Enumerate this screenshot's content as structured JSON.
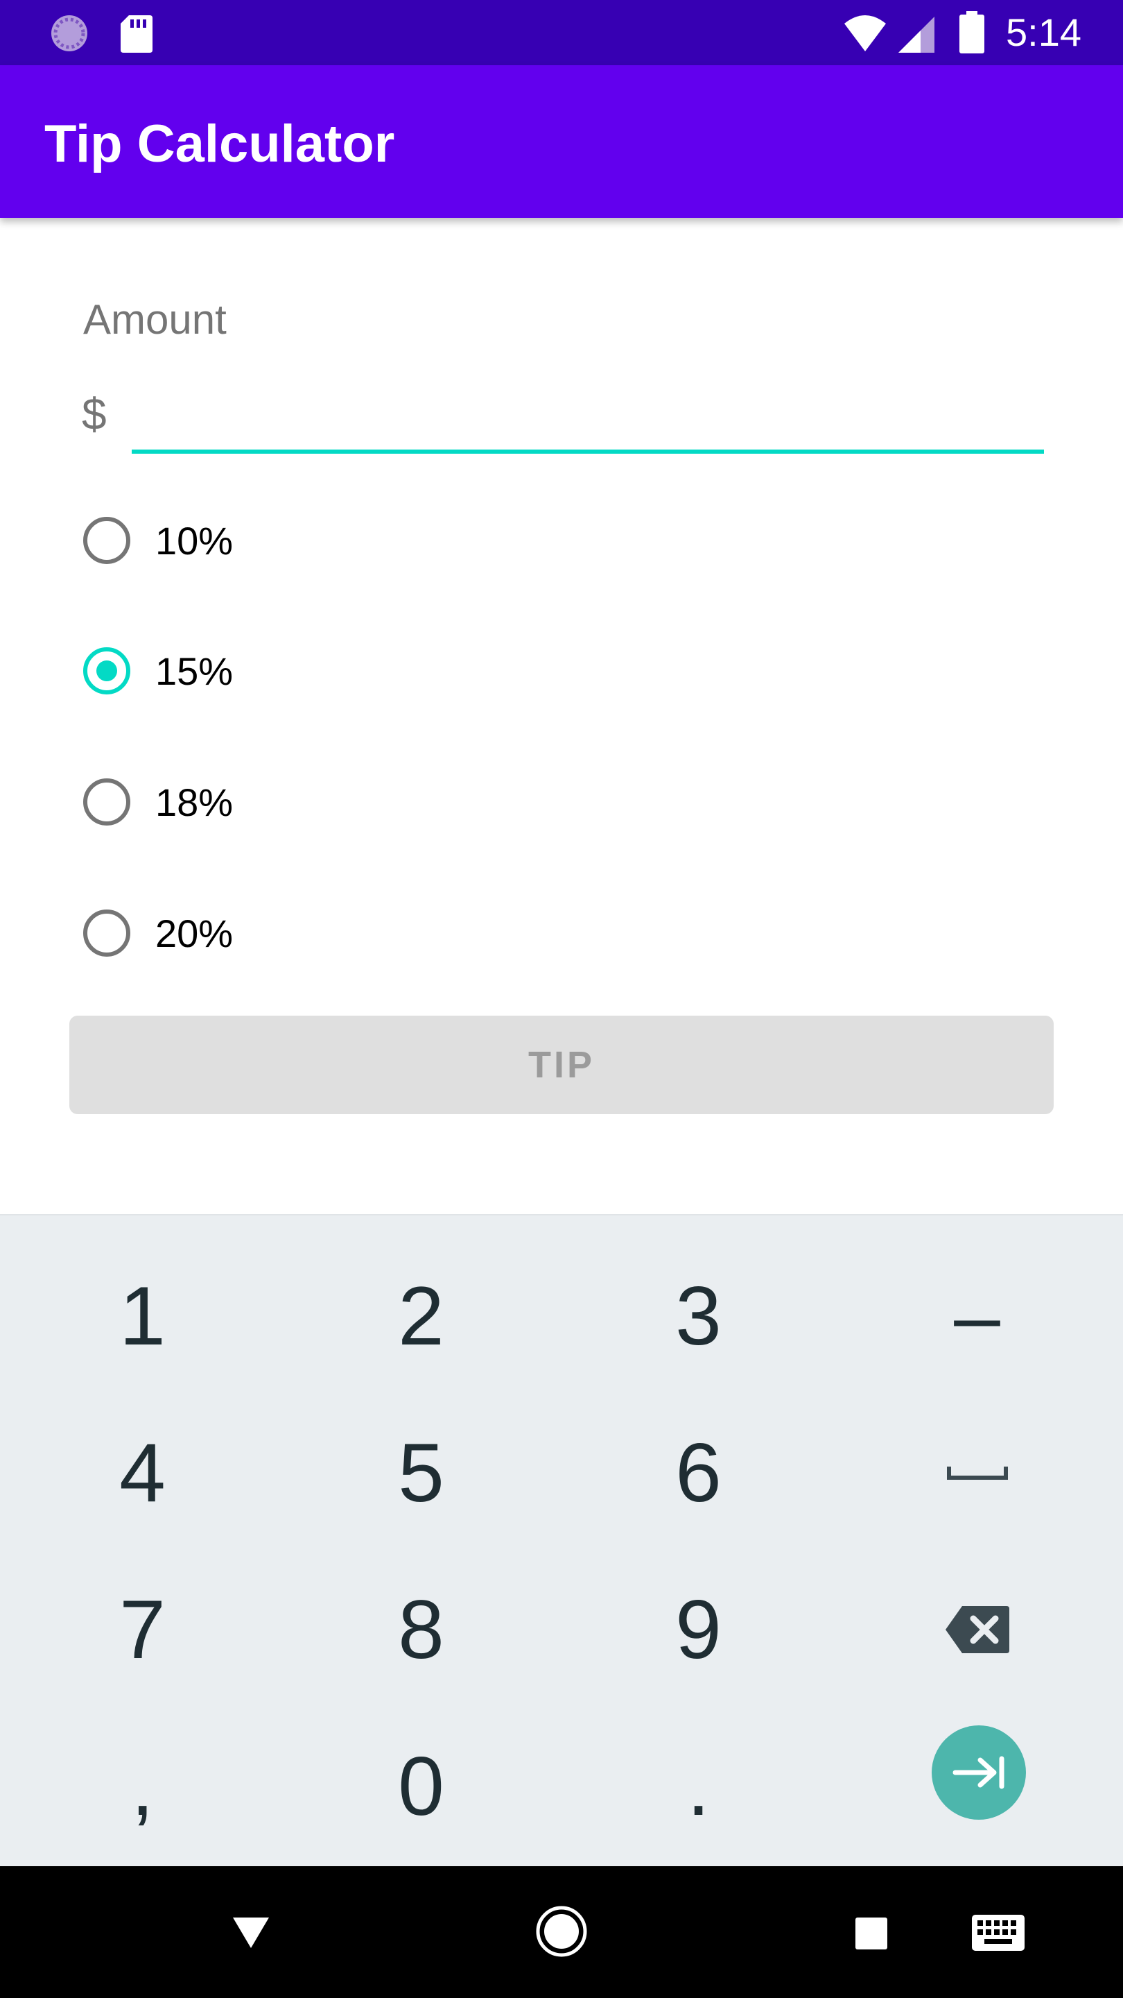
{
  "status_bar": {
    "time": "5:14",
    "left_icons": [
      "loading-icon",
      "sd-card-icon"
    ],
    "right_icons": [
      "wifi-icon",
      "signal-icon",
      "battery-icon"
    ],
    "color": "#3700b3"
  },
  "app_bar": {
    "title": "Tip Calculator",
    "color": "#6200ee"
  },
  "form": {
    "amount_label": "Amount",
    "currency_prefix": "$",
    "amount_value": "",
    "tip_options": [
      {
        "label": "10%",
        "checked": false
      },
      {
        "label": "15%",
        "checked": true
      },
      {
        "label": "18%",
        "checked": false
      },
      {
        "label": "20%",
        "checked": false
      }
    ],
    "tip_button_label": "TIP",
    "accent_color": "#03dac5"
  },
  "keyboard": {
    "rows": [
      [
        "1",
        "2",
        "3",
        "–"
      ],
      [
        "4",
        "5",
        "6",
        "space"
      ],
      [
        "7",
        "8",
        "9",
        "backspace"
      ],
      [
        ",",
        "0",
        ".",
        "next"
      ]
    ],
    "go_key_color": "#4db6ac"
  },
  "nav_bar": {
    "icons": [
      "back-icon",
      "home-icon",
      "recents-icon",
      "keyboard-switch-icon"
    ]
  }
}
